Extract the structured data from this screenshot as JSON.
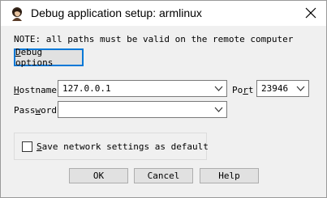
{
  "window": {
    "title": "Debug application setup: armlinux",
    "app_icon": "ida-avatar-icon",
    "close_icon": "close-icon"
  },
  "note": "NOTE: all paths must be valid on the remote computer",
  "debug_options_button": {
    "label_pre": "",
    "label_mnemonic": "D",
    "label_post": "ebug options"
  },
  "hostname": {
    "label_mnemonic": "H",
    "label_post": "ostname",
    "value": "127.0.0.1"
  },
  "port": {
    "label_pre": "Po",
    "label_mnemonic": "r",
    "label_post": "t",
    "value": "23946"
  },
  "password": {
    "label_pre": "Pass",
    "label_mnemonic": "w",
    "label_post": "ord",
    "value": ""
  },
  "save_settings": {
    "label_pre": "",
    "label_mnemonic": "S",
    "label_post": "ave network settings as default",
    "checked": false
  },
  "buttons": {
    "ok": "OK",
    "cancel": "Cancel",
    "help": "Help"
  },
  "colors": {
    "focus_border": "#0078d7",
    "dialog_bg": "#f0f0f0"
  }
}
